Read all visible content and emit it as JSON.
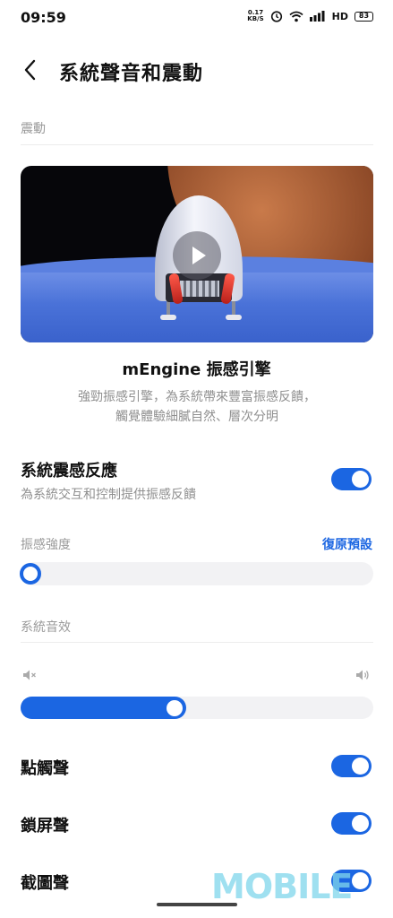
{
  "status_bar": {
    "time": "09:59",
    "net_speed_value": "0.17",
    "net_speed_unit": "KB/S",
    "hd": "HD",
    "battery": "83"
  },
  "header": {
    "title": "系統聲音和震動"
  },
  "vibration_section": {
    "label": "震動"
  },
  "video": {
    "icon": "play-icon"
  },
  "mengine": {
    "title": "mEngine 振感引擎",
    "description_line1": "強勁振感引擎，為系統帶來豐富振感反饋，",
    "description_line2": "觸覺體驗細膩自然、層次分明"
  },
  "system_haptic": {
    "title": "系統震感反應",
    "subtitle": "為系統交互和控制提供振感反饋",
    "enabled": true
  },
  "vibration_intensity": {
    "label": "振感強度",
    "reset_label": "復原預設",
    "level_percent": 0
  },
  "system_sound_section": {
    "label": "系統音效"
  },
  "volume": {
    "level_percent": 47,
    "mute_icon": "volume-mute-icon",
    "max_icon": "volume-up-icon"
  },
  "toggles": [
    {
      "label": "點觸聲",
      "enabled": true
    },
    {
      "label": "鎖屏聲",
      "enabled": true
    },
    {
      "label": "截圖聲",
      "enabled": true
    }
  ],
  "watermark": "MOBILE",
  "colors": {
    "accent": "#1b66e2",
    "muted_text": "#8f8f8f",
    "track": "#f2f2f4"
  }
}
